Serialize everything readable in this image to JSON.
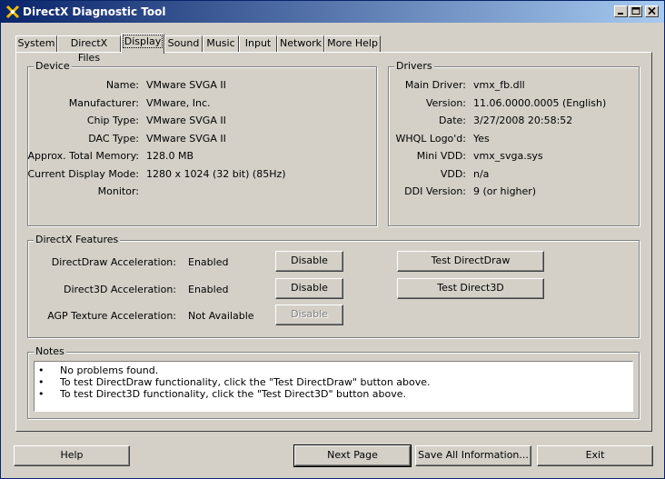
{
  "window": {
    "title": "DirectX Diagnostic Tool"
  },
  "tabs": [
    {
      "label": "System"
    },
    {
      "label": "DirectX Files"
    },
    {
      "label": "Display",
      "active": true
    },
    {
      "label": "Sound"
    },
    {
      "label": "Music"
    },
    {
      "label": "Input"
    },
    {
      "label": "Network"
    },
    {
      "label": "More Help"
    }
  ],
  "device": {
    "title": "Device",
    "rows": [
      {
        "label": "Name:",
        "value": "VMware SVGA II"
      },
      {
        "label": "Manufacturer:",
        "value": "VMware, Inc."
      },
      {
        "label": "Chip Type:",
        "value": "VMware SVGA II"
      },
      {
        "label": "DAC Type:",
        "value": "VMware SVGA II"
      },
      {
        "label": "Approx. Total Memory:",
        "value": "128.0 MB"
      },
      {
        "label": "Current Display Mode:",
        "value": "1280 x 1024 (32 bit) (85Hz)"
      },
      {
        "label": "Monitor:",
        "value": ""
      }
    ]
  },
  "drivers": {
    "title": "Drivers",
    "rows": [
      {
        "label": "Main Driver:",
        "value": "vmx_fb.dll"
      },
      {
        "label": "Version:",
        "value": "11.06.0000.0005 (English)"
      },
      {
        "label": "Date:",
        "value": "3/27/2008 20:58:52"
      },
      {
        "label": "WHQL Logo'd:",
        "value": "Yes"
      },
      {
        "label": "Mini VDD:",
        "value": "vmx_svga.sys"
      },
      {
        "label": "VDD:",
        "value": "n/a"
      },
      {
        "label": "DDI Version:",
        "value": "9 (or higher)"
      }
    ]
  },
  "features": {
    "title": "DirectX Features",
    "rows": [
      {
        "label": "DirectDraw Acceleration:",
        "value": "Enabled",
        "button": "Disable",
        "enabled": true
      },
      {
        "label": "Direct3D Acceleration:",
        "value": "Enabled",
        "button": "Disable",
        "enabled": true
      },
      {
        "label": "AGP Texture Acceleration:",
        "value": "Not Available",
        "button": "Disable",
        "enabled": false
      }
    ],
    "test_directdraw": "Test DirectDraw",
    "test_direct3d": "Test Direct3D"
  },
  "notes": {
    "title": "Notes",
    "bullet": "•",
    "lines": [
      "No problems found.",
      "To test DirectDraw functionality, click the \"Test DirectDraw\" button above.",
      "To test Direct3D functionality, click the \"Test Direct3D\" button above."
    ]
  },
  "footer": {
    "help": "Help",
    "next_page": "Next Page",
    "save_all": "Save All Information...",
    "exit": "Exit"
  },
  "colors": {
    "title_start": "#0a246a",
    "title_end": "#a6caf0",
    "face": "#d4d0c8"
  }
}
